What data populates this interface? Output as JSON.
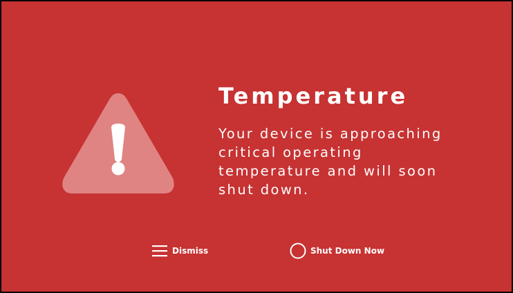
{
  "alert": {
    "title": "Temperature",
    "message": "Your device is approaching critical operating temperature and will soon shut down."
  },
  "actions": {
    "dismiss_label": "Dismiss",
    "shutdown_label": "Shut Down Now"
  },
  "icons": {
    "warning": "warning-triangle-icon",
    "dismiss": "menu-lines-icon",
    "shutdown": "circle-icon"
  },
  "colors": {
    "background": "#c73232",
    "warning_triangle": "#e08383",
    "text": "#ffffff",
    "frame": "#000000"
  }
}
